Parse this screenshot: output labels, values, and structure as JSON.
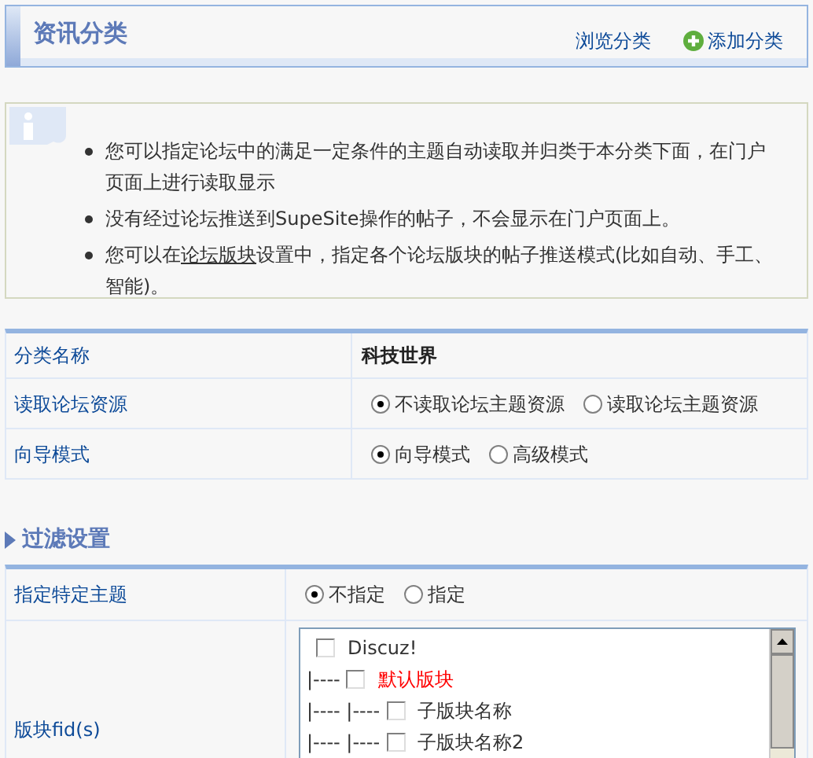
{
  "header": {
    "title": "资讯分类",
    "links": [
      {
        "label": "浏览分类",
        "kind": "plain"
      },
      {
        "label": "添加分类",
        "kind": "add"
      }
    ]
  },
  "info": {
    "items": [
      {
        "text": "您可以指定论坛中的满足一定条件的主题自动读取并归类于本分类下面，在门户页面上进行读取显示"
      },
      {
        "text": "没有经过论坛推送到SupeSite操作的帖子，不会显示在门户页面上。"
      },
      {
        "before": "您可以在",
        "link": "论坛版块",
        "after": "设置中，指定各个论坛版块的帖子推送模式(比如自动、手工、智能)。"
      }
    ]
  },
  "settings": [
    {
      "label": "分类名称",
      "kind": "text",
      "value": "科技世界"
    },
    {
      "label": "读取论坛资源",
      "kind": "radio",
      "options": [
        {
          "label": "不读取论坛主题资源",
          "selected": true
        },
        {
          "label": "读取论坛主题资源",
          "selected": false
        }
      ]
    },
    {
      "label": "向导模式",
      "kind": "radio",
      "options": [
        {
          "label": "向导模式",
          "selected": true
        },
        {
          "label": "高级模式",
          "selected": false
        }
      ]
    }
  ],
  "filter": {
    "title": "过滤设置",
    "rows": [
      {
        "label": "指定特定主题",
        "kind": "radio",
        "options": [
          {
            "label": "不指定",
            "selected": true
          },
          {
            "label": "指定",
            "selected": false
          }
        ]
      },
      {
        "label": "版块fid(s)",
        "kind": "tree",
        "items": [
          {
            "label": "Discuz!",
            "checked": false,
            "color": "#333333",
            "children": [
              {
                "prefix": "|----",
                "label": "默认版块",
                "checked": false,
                "color": "#ff0000",
                "children": [
                  {
                    "prefix": "|---- |----",
                    "label": "子版块名称",
                    "checked": false,
                    "color": "#333333"
                  },
                  {
                    "prefix": "|---- |----",
                    "label": "子版块名称2",
                    "checked": false,
                    "color": "#333333"
                  }
                ]
              }
            ]
          }
        ]
      }
    ]
  }
}
